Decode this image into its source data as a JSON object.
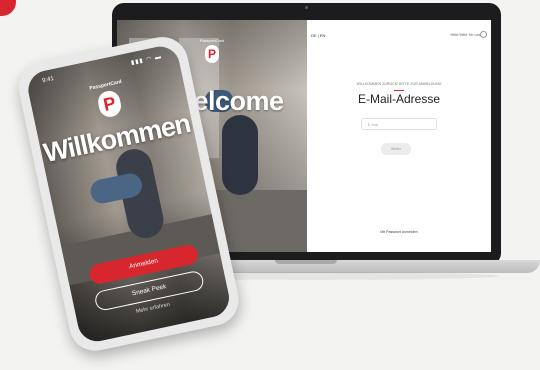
{
  "laptop": {
    "welcome": "Welcome",
    "brand": "PassportCard",
    "logo_letter": "P",
    "lang": "DE | EN",
    "help": "Hilfe/Hilfe für uns",
    "subtitle": "WILLKOMMEN ZURÜCK! BITTE ZUR ANMELDUNG",
    "email_title": "E-Mail-Adresse",
    "email_placeholder": "E-Mail",
    "continue_label": "Weiter",
    "forgot_label": "Mit Passwort anmelden"
  },
  "phone": {
    "time": "9:41",
    "status_icons": "▮▮▮ ◠ ▬",
    "brand": "PassportCard",
    "logo_letter": "P",
    "title": "Willkommen",
    "login_label": "Anmelden",
    "sneak_label": "Sneak Peek",
    "more_label": "Mehr erfahren"
  },
  "colors": {
    "accent": "#d8262f",
    "background": "#f3f3f1"
  }
}
